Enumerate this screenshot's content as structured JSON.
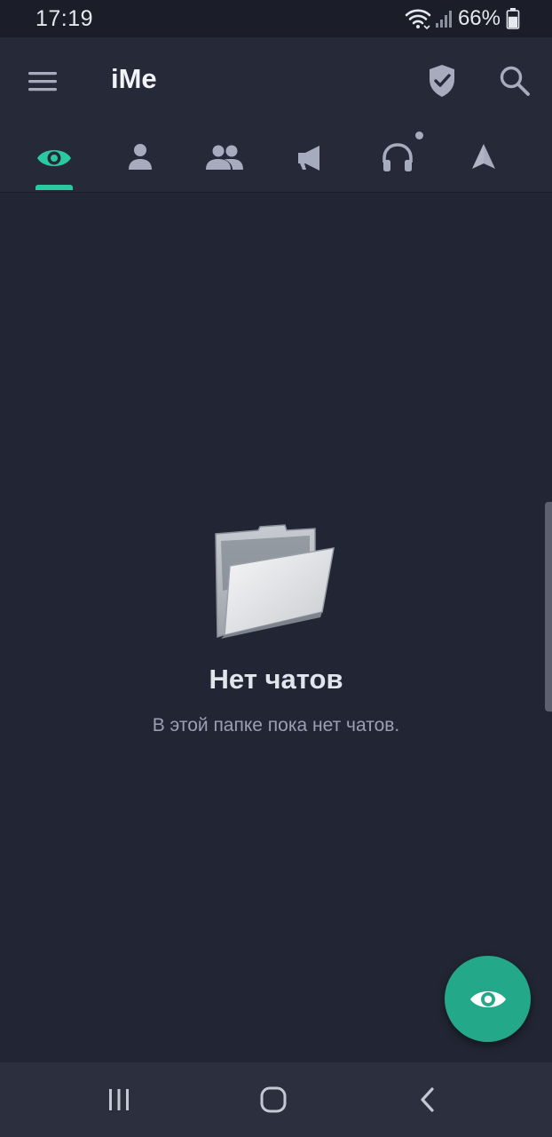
{
  "status_bar": {
    "time": "17:19",
    "battery_percent": "66%",
    "battery_level": 0.66,
    "icons": [
      "wifi-icon",
      "cellular-signal-icon",
      "battery-icon"
    ]
  },
  "app_bar": {
    "title": "iMe",
    "icons": [
      "hamburger-menu-icon",
      "shield-check-icon",
      "search-icon"
    ]
  },
  "tabs": [
    {
      "icon": "eye-icon",
      "selected": true
    },
    {
      "icon": "person-icon",
      "selected": false
    },
    {
      "icon": "group-icon",
      "selected": false
    },
    {
      "icon": "megaphone-icon",
      "selected": false
    },
    {
      "icon": "headphones-icon",
      "selected": false,
      "badge_dot": true
    },
    {
      "icon": "triangle-icon",
      "selected": false
    }
  ],
  "empty_state": {
    "icon": "open-folder-icon",
    "title": "Нет чатов",
    "subtitle": "В этой папке пока нет чатов."
  },
  "fab": {
    "icon": "eye-icon"
  },
  "navigation_bar": {
    "icons": [
      "recent-apps-icon",
      "home-icon",
      "back-icon"
    ]
  },
  "colors": {
    "background": "#222634",
    "app_bar": "#252938",
    "accent": "#2bc9a1",
    "fab": "#23a98a",
    "icon_inactive": "#a6abbd",
    "text_primary": "#e3e5ec",
    "text_secondary": "#9aa0b3",
    "nav_bar": "#2b2f3e"
  }
}
